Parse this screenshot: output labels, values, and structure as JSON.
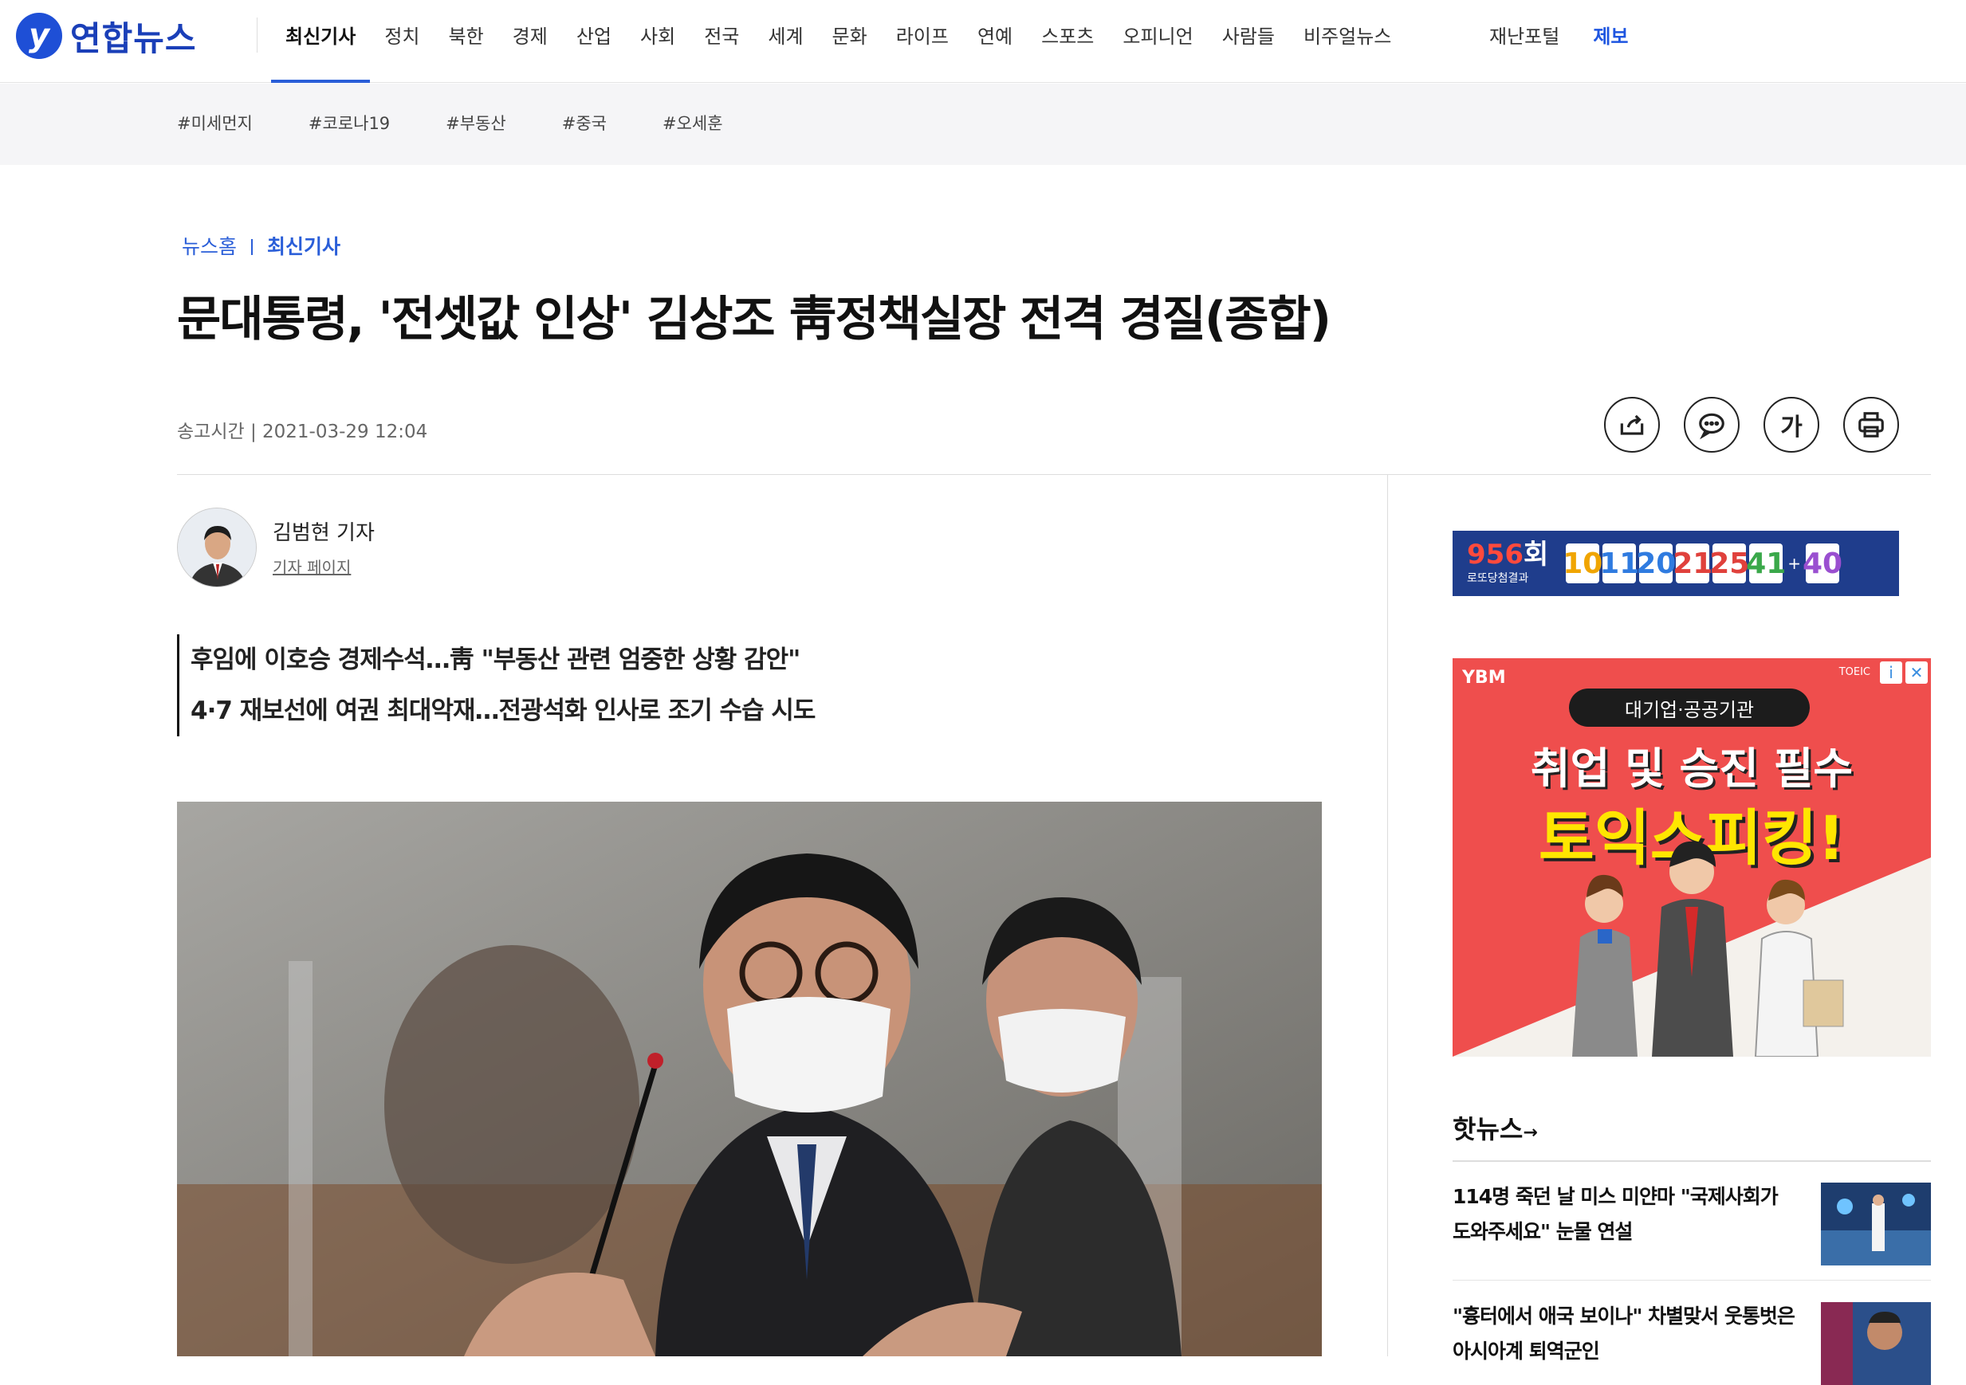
{
  "brand": {
    "logo_mark": "y",
    "name": "연합뉴스"
  },
  "nav": {
    "items": [
      "최신기사",
      "정치",
      "북한",
      "경제",
      "산업",
      "사회",
      "전국",
      "세계",
      "문화",
      "라이프",
      "연예",
      "스포츠",
      "오피니언",
      "사람들",
      "비주얼뉴스"
    ],
    "active": "최신기사",
    "right": [
      "재난포털",
      "제보"
    ]
  },
  "tags": [
    "#미세먼지",
    "#코로나19",
    "#부동산",
    "#중국",
    "#오세훈"
  ],
  "breadcrumb": {
    "home": "뉴스홈",
    "current": "최신기사"
  },
  "article": {
    "headline": "문대통령, '전셋값 인상' 김상조 靑정책실장 전격 경질(종합)",
    "sent_label": "송고시간",
    "sent_time": "2021-03-29 12:04",
    "author": "김범현 기자",
    "author_link": "기자 페이지",
    "summary": [
      "후임에 이호승 경제수석…靑 \"부동산 관련 엄중한 상황 감안\"",
      "4·7 재보선에 여권 최대악재…전광석화 인사로 조기 수습 시도"
    ]
  },
  "tools": [
    {
      "icon": "share-icon"
    },
    {
      "icon": "comment-icon"
    },
    {
      "icon": "font-size-icon",
      "label": "가"
    },
    {
      "icon": "print-icon"
    }
  ],
  "lotto": {
    "round_num": "956",
    "round_suffix": "회",
    "subtitle": "로또당첨결과",
    "numbers": [
      "10",
      "11",
      "20",
      "21",
      "25",
      "41"
    ],
    "bonus": "40",
    "plus": "+",
    "colors": [
      "#f0a500",
      "#2f7be0",
      "#2f7be0",
      "#e0413c",
      "#e0413c",
      "#3aa84a",
      "#9a4fd0"
    ]
  },
  "ad": {
    "top_mark": "YBM",
    "brand": "TOEIC",
    "badge": "대기업·공공기관",
    "line1": "취업 및 승진 필수",
    "line2": "토익스피킹!",
    "info": "i",
    "close": "✕"
  },
  "hot_news": {
    "title": "핫뉴스",
    "arrow": "→",
    "items": [
      "114명 죽던 날 미스 미얀마 \"국제사회가 도와주세요\" 눈물 연설",
      "\"흉터에서 애국 보이나\" 차별맞서 웃통벗은 아시아계 퇴역군인"
    ]
  }
}
